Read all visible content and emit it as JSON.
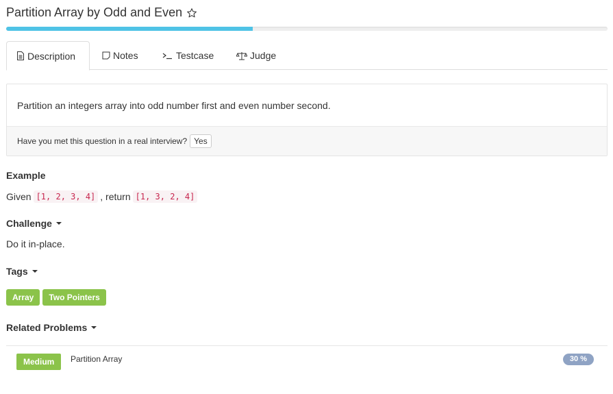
{
  "problem": {
    "title": "Partition Array by Odd and Even",
    "progress_percent": 41
  },
  "tabs": [
    {
      "label": "Description",
      "icon": "document-icon",
      "active": true
    },
    {
      "label": "Notes",
      "icon": "note-icon",
      "active": false
    },
    {
      "label": "Testcase",
      "icon": "terminal-icon",
      "active": false
    },
    {
      "label": "Judge",
      "icon": "scale-icon",
      "active": false
    }
  ],
  "description": {
    "text": "Partition an integers array into odd number first and even number second.",
    "interview_question": "Have you met this question in a real interview?",
    "yes_label": "Yes"
  },
  "example": {
    "heading": "Example",
    "given_label": "Given",
    "input_code": "[1, 2, 3, 4]",
    "return_label": ", return",
    "output_code": "[1, 3, 2, 4]"
  },
  "challenge": {
    "heading": "Challenge",
    "text": "Do it in-place."
  },
  "tags": {
    "heading": "Tags",
    "items": [
      "Array",
      "Two Pointers"
    ]
  },
  "related": {
    "heading": "Related Problems",
    "items": [
      {
        "difficulty": "Medium",
        "title": "Partition Array",
        "percent": "30 %"
      }
    ]
  },
  "colors": {
    "accent_progress": "#4fc3e6",
    "tag_green": "#8bc34a",
    "code_red": "#c7254e",
    "percent_badge": "#8fa3c4"
  }
}
